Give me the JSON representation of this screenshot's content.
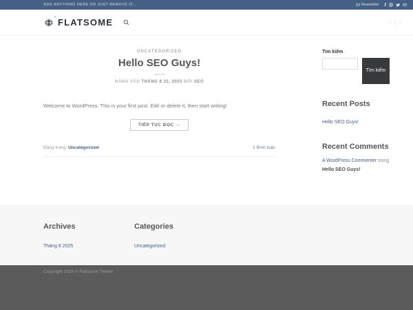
{
  "topbar": {
    "left_text": "ADD ANYTHING HERE OR JUST REMOVE IT...",
    "newsletter_label": "Newsletter",
    "facebook_glyph": "f"
  },
  "header": {
    "logo_text": "FLATSOME",
    "registered_mark": "®",
    "nav_prev": "‹",
    "nav_next": "›"
  },
  "post": {
    "category": "UNCATEGORIZED",
    "title": "Hello SEO Guys!",
    "meta": {
      "posted_on": "ĐĂNG VÀO",
      "date": "THÁNG 8 25, 2025",
      "by": "BỞI",
      "author": "SEO"
    },
    "excerpt": "Welcome to WordPress. This is your first post. Edit or delete it, then start writing!",
    "read_more_label": "TIẾP TỤC ĐỌC →",
    "posted_in": "Đăng trong",
    "category_link": "Uncategorized",
    "comments_link": "1 Bình luận"
  },
  "sidebar": {
    "search": {
      "label": "Tìm kiếm",
      "button_label": "Tìm kiếm",
      "input_value": ""
    },
    "recent_posts": {
      "title": "Recent Posts",
      "items": [
        "Hello SEO Guys!"
      ]
    },
    "recent_comments": {
      "title": "Recent Comments",
      "author": "A WordPress Commenter",
      "connector": "trong",
      "post": "Hello SEO Guys!"
    }
  },
  "footer": {
    "archives": {
      "title": "Archives",
      "items": [
        "Tháng 8 2025"
      ]
    },
    "categories": {
      "title": "Categories",
      "items": [
        "Uncategorized"
      ]
    },
    "copyright": "Copyright 2026 © Flatsome Theme"
  },
  "colors": {
    "topbar_bg": "#446084",
    "link": "#446084",
    "search_button_bg": "#37393b",
    "footer_bg": "#f7f7f7",
    "absolute_footer_bg": "#5b5b5b"
  }
}
